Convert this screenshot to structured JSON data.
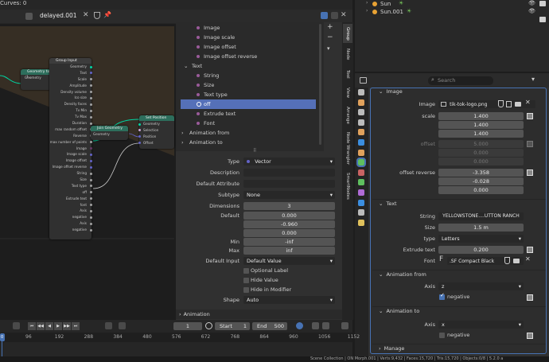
{
  "top_bar": {
    "tree_name": "delayed.001",
    "left_readout": "Curves: 0",
    "outliner_items": [
      {
        "name": "Sun"
      },
      {
        "name": "Sun.001"
      }
    ]
  },
  "node_editor": {
    "group_input_title": "Group Input",
    "group_input_sockets": [
      "Geometry",
      "Text",
      "Scale",
      "Amplitude",
      "Density volume",
      "Ico size",
      "Density faces",
      "Tv Min",
      "Tv Max",
      "Duration",
      "max random offset",
      "Reverse",
      "max number of points",
      "Image",
      "Image scale",
      "Image offset",
      "Image offset reverse",
      "String",
      "Size",
      "Text type",
      "off",
      "Extrude text",
      "font",
      "Axis",
      "negative",
      "Axis",
      "negative"
    ],
    "geo_to_node_title": "Geometry to I...",
    "geo_to_node_socket": "Geometry",
    "join_title": "Join Geometry",
    "join_socket": "Geometry",
    "set_position_title": "Set Position",
    "set_position_sockets": [
      "Geometry",
      "Selection",
      "Position",
      "Offset"
    ]
  },
  "interface_tree": {
    "items": [
      {
        "label": "Image",
        "type": "dot"
      },
      {
        "label": "Image scale",
        "type": "dot"
      },
      {
        "label": "Image offset",
        "type": "dot"
      },
      {
        "label": "Image offset reverse",
        "type": "dot"
      }
    ],
    "text_panel": "Text",
    "text_items": [
      {
        "label": "String",
        "type": "dot"
      },
      {
        "label": "Size",
        "type": "dot"
      },
      {
        "label": "Text type",
        "type": "dot"
      },
      {
        "label": "off",
        "type": "selected"
      },
      {
        "label": "Extrude text",
        "type": "dot"
      },
      {
        "label": "Font",
        "type": "dot"
      }
    ],
    "animation_from": "Animation from",
    "animation_to": "Animation to"
  },
  "socket_props": {
    "type_label": "Type",
    "type_value": "Vector",
    "description_label": "Description",
    "default_attr_label": "Default Attribute",
    "subtype_label": "Subtype",
    "subtype_value": "None",
    "dimensions_label": "Dimensions",
    "dimensions_value": "3",
    "default_label": "Default",
    "default_values": [
      "0.000",
      "-0.960",
      "0.000"
    ],
    "min_label": "Min",
    "min_value": "-inf",
    "max_label": "Max",
    "max_value": "inf",
    "default_input_label": "Default Input",
    "default_input_value": "Default Value",
    "optional_label": "Optional Label",
    "hide_value": "Hide Value",
    "hide_modifier": "Hide in Modifier",
    "shape_label": "Shape",
    "shape_value": "Auto",
    "animation_panel": "Animation"
  },
  "vtabs": [
    "Group",
    "Node",
    "Tool",
    "View",
    "Arrange",
    "Node Wrangler",
    "SmartNodes"
  ],
  "modifier": {
    "search_placeholder": "Search",
    "image_panel": "Image",
    "image_label": "Image",
    "image_value": "tik-tok-logo.png",
    "scale_label": "scale",
    "scale_values": [
      "1.400",
      "1.400",
      "1.400"
    ],
    "offset_label": "offset",
    "offset_values": [
      "5.000",
      "0.000",
      "0.000"
    ],
    "offset_reverse_label": "offset reverse",
    "offset_reverse_values": [
      "-3.358",
      "-0.028",
      "0.000"
    ],
    "text_panel": "Text",
    "string_label": "String",
    "string_value": "YELLOWSTONE....UTTON RANCH",
    "size_label": "Size",
    "size_value": "1.5 m",
    "type_label": "type",
    "type_value": "Letters",
    "extrude_label": "Extrude text",
    "extrude_value": "0.200",
    "font_label": "Font",
    "font_value": ".SF Compact Black",
    "anim_from_panel": "Animation from",
    "axis_label": "Axis",
    "axis_from_value": "z",
    "negative_label": "negative",
    "anim_to_panel": "Animation to",
    "axis_to_value": "x",
    "manage_panel": "Manage"
  },
  "timeline": {
    "current_frame": "1",
    "start_label": "Start",
    "start_value": "1",
    "end_label": "End",
    "end_value": "500",
    "ruler": [
      "96",
      "192",
      "288",
      "384",
      "480",
      "576",
      "672",
      "768",
      "864",
      "960",
      "1056",
      "1152"
    ],
    "frame_marker": "0"
  },
  "status_bar": {
    "text": "Scene Collection | ON Morph.001 | Verts:9,432 | Faces:15,720 | Tris:15,720 | Objects:0/8 | 5.2.0 a"
  },
  "colors": {
    "accent": "#4772b3",
    "selection": "#5570b8",
    "geometry_socket": "#00d6a3",
    "vector_socket": "#6363c7"
  }
}
